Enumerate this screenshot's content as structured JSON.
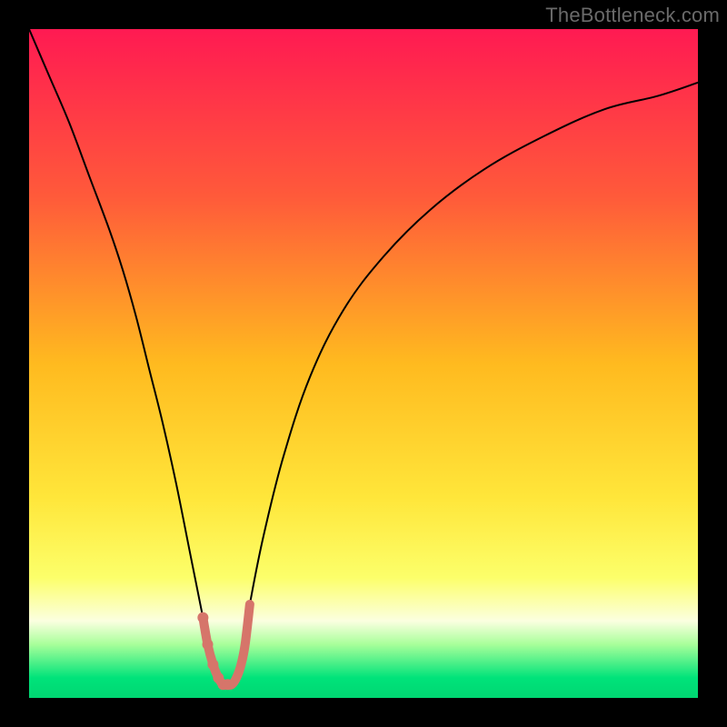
{
  "watermark": "TheBottleneck.com",
  "chart_data": {
    "type": "line",
    "title": "",
    "xlabel": "",
    "ylabel": "",
    "xlim": [
      0,
      100
    ],
    "ylim": [
      0,
      100
    ],
    "background_gradient": {
      "stops": [
        {
          "offset": 0,
          "color": "#ff1a52"
        },
        {
          "offset": 0.25,
          "color": "#ff5a3a"
        },
        {
          "offset": 0.5,
          "color": "#ffba1f"
        },
        {
          "offset": 0.7,
          "color": "#ffe63a"
        },
        {
          "offset": 0.82,
          "color": "#fcff6a"
        },
        {
          "offset": 0.885,
          "color": "#fbffe0"
        },
        {
          "offset": 0.92,
          "color": "#a8ff9a"
        },
        {
          "offset": 0.97,
          "color": "#00e37a"
        },
        {
          "offset": 1.0,
          "color": "#00d672"
        }
      ]
    },
    "series": [
      {
        "name": "bottleneck-curve",
        "color": "#000000",
        "stroke_width": 2,
        "x": [
          0,
          3,
          6,
          9,
          12,
          14,
          16,
          18,
          20,
          22,
          24,
          26,
          27,
          28,
          29,
          30,
          31,
          32,
          33,
          35,
          38,
          42,
          47,
          53,
          60,
          68,
          77,
          86,
          94,
          100
        ],
        "values": [
          100,
          93,
          86,
          78,
          70,
          64,
          57,
          49,
          41,
          32,
          22,
          12,
          7,
          4,
          2,
          2,
          4,
          8,
          14,
          24,
          36,
          48,
          58,
          66,
          73,
          79,
          84,
          88,
          90,
          92
        ]
      }
    ],
    "highlight_segment": {
      "name": "valley-marker",
      "color": "#d6756a",
      "stroke_width": 10,
      "x": [
        26,
        26.7,
        27.5,
        28.3,
        29,
        29.7,
        30.3,
        31,
        31.7,
        32.3,
        33
      ],
      "values": [
        12,
        8,
        5,
        3,
        2,
        2,
        2,
        3,
        5,
        8,
        14
      ]
    },
    "highlight_points": {
      "name": "valley-points",
      "color": "#d6756a",
      "radius": 6,
      "x": [
        26,
        26.7,
        27.5,
        28.3,
        29,
        29.7
      ],
      "values": [
        12,
        8,
        5,
        3,
        2,
        2
      ]
    }
  }
}
